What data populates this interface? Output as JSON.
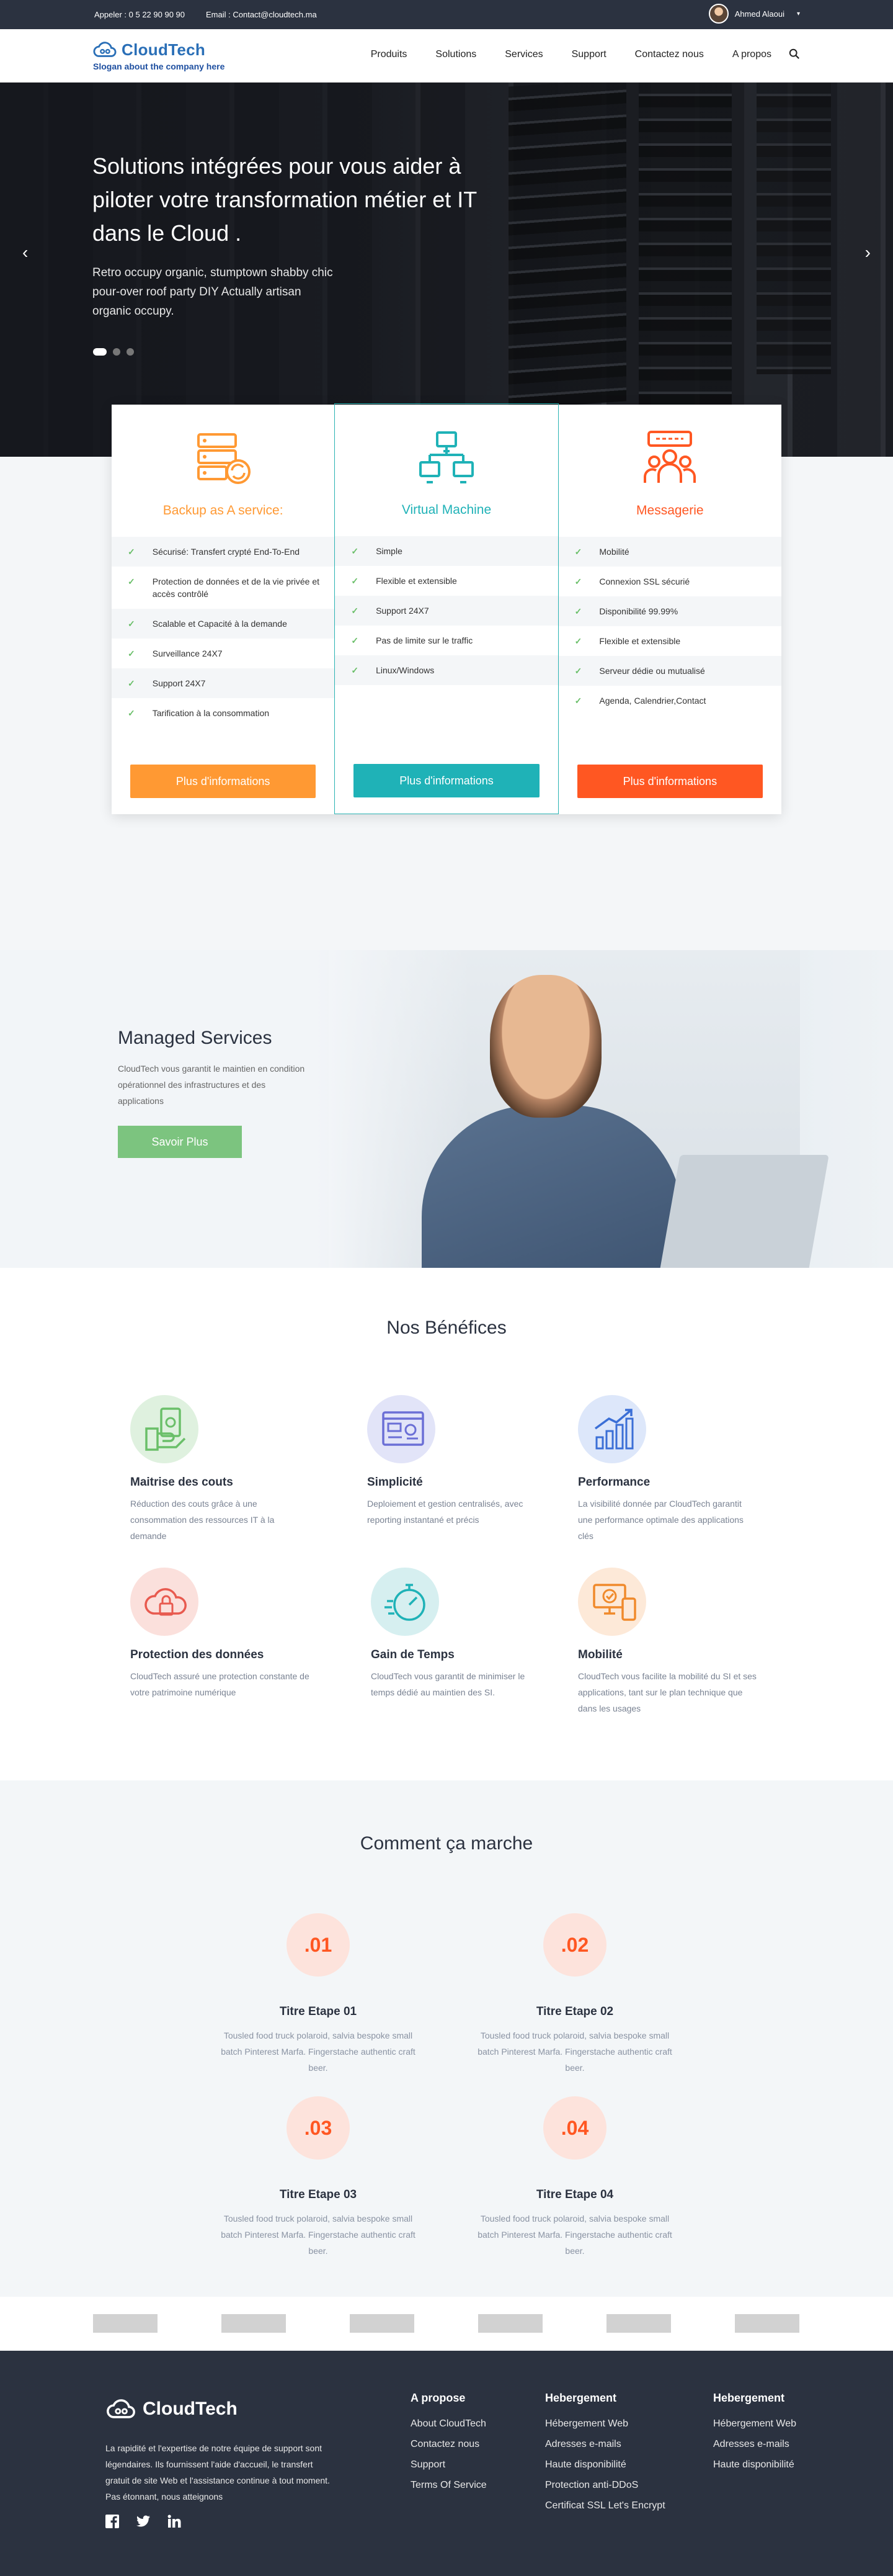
{
  "topbar": {
    "phone": "Appeler : 0 5 22 90 90 90",
    "email": "Email : Contact@cloudtech.ma",
    "user_name": "Ahmed Alaoui",
    "caret": "▾"
  },
  "header": {
    "logo_text": "CloudTech",
    "slogan": "Slogan about the company here",
    "nav": [
      "Produits",
      "Solutions",
      "Services",
      "Support",
      "Contactez nous",
      "A propos"
    ]
  },
  "hero": {
    "title": "Solutions intégrées pour vous aider à piloter votre transformation métier et IT dans le Cloud .",
    "text": "Retro occupy organic, stumptown shabby chic pour-over roof party DIY  Actually artisan organic occupy.",
    "prev": "‹",
    "next": "›"
  },
  "cards": [
    {
      "title": "Backup as A service:",
      "color": "#ff9933",
      "icon": "server-backup-icon",
      "features": [
        "Sécurisé:  Transfert crypté End-To-End",
        "Protection de données et de la vie privée et accès contrôlé",
        "Scalable et Capacité à la demande",
        "Surveillance 24X7",
        "Support 24X7",
        "Tarification à la consommation"
      ],
      "button": "Plus d'informations"
    },
    {
      "title": "Virtual Machine",
      "color": "#1fb2b7",
      "icon": "network-monitors-icon",
      "features": [
        "Simple",
        "Flexible et extensible",
        "Support 24X7",
        "Pas de limite sur le traffic",
        "Linux/Windows"
      ],
      "button": "Plus d'informations"
    },
    {
      "title": "Messagerie",
      "color": "#ff5722",
      "icon": "team-chat-icon",
      "features": [
        "Mobilité",
        "Connexion SSL sécurié",
        "Disponibilité 99.99%",
        "Flexible et extensible",
        "Serveur dédie ou mutualisé",
        "Agenda, Calendrier,Contact"
      ],
      "button": "Plus d'informations"
    }
  ],
  "managed": {
    "title": "Managed Services",
    "text": "CloudTech vous garantit le maintien en condition opérationnel des infrastructures et des applications",
    "button": "Savoir Plus"
  },
  "benefits": {
    "title": "Nos Bénéfices",
    "items": [
      {
        "title": "Maitrise des couts",
        "text": "Réduction des couts grâce à une consommation des ressources IT à la demande",
        "icon": "money-icon",
        "tint": "#dff1df",
        "color": "#6abf69"
      },
      {
        "title": "Simplicité",
        "text": "Deploiement et gestion centralisés, avec reporting instantané et précis",
        "icon": "dashboard-window-icon",
        "tint": "#e2e4f8",
        "color": "#6b6fd6"
      },
      {
        "title": "Performance",
        "text": "La visibilité donnée par CloudTech garantit une performance optimale des applications clés",
        "icon": "growth-chart-icon",
        "tint": "#dde7fa",
        "color": "#3b6fd6"
      },
      {
        "title": "Protection des données",
        "text": "CloudTech assuré une protection constante de votre patrimoine numérique",
        "icon": "cloud-lock-icon",
        "tint": "#fbe0dc",
        "color": "#e85a4f"
      },
      {
        "title": "Gain de Temps",
        "text": "CloudTech vous garantit de minimiser le temps dédié au maintien des SI.",
        "icon": "stopwatch-icon",
        "tint": "#d6eff0",
        "color": "#1fb2b7"
      },
      {
        "title": "Mobilité",
        "text": "CloudTech vous facilite la mobilité du SI et ses applications, tant sur le plan technique que dans les usages",
        "icon": "devices-check-icon",
        "tint": "#fde9d8",
        "color": "#f08a2c"
      }
    ]
  },
  "how": {
    "title": "Comment ça marche",
    "steps": [
      {
        "num": ".01",
        "title": "Titre Etape 01",
        "text": "Tousled food truck polaroid, salvia bespoke small batch Pinterest Marfa. Fingerstache authentic craft beer."
      },
      {
        "num": ".02",
        "title": "Titre Etape 02",
        "text": "Tousled food truck polaroid, salvia bespoke small batch Pinterest Marfa. Fingerstache authentic craft beer."
      },
      {
        "num": ".03",
        "title": "Titre Etape 03",
        "text": "Tousled food truck polaroid, salvia bespoke small batch Pinterest Marfa. Fingerstache authentic craft beer."
      },
      {
        "num": ".04",
        "title": "Titre Etape 04",
        "text": "Tousled food truck polaroid, salvia bespoke small batch Pinterest Marfa. Fingerstache authentic craft beer."
      }
    ]
  },
  "footer": {
    "logo_text": "CloudTech",
    "about": "La rapidité et l'expertise de notre équipe de support sont légendaires. Ils fournissent l'aide d'accueil, le transfert gratuit de site Web et l'assistance continue à tout moment. Pas étonnant, nous atteignons",
    "columns": [
      {
        "title": "A propose",
        "links": [
          "About CloudTech",
          "Contactez nous",
          "Support",
          "Terms Of Service"
        ]
      },
      {
        "title": "Hebergement",
        "links": [
          "Hébergement Web",
          "Adresses e-mails",
          "Haute disponibilité",
          "Protection anti-DDoS",
          "Certificat SSL Let's Encrypt"
        ]
      },
      {
        "title": "Hebergement",
        "links": [
          "Hébergement Web",
          "Adresses e-mails",
          "Haute disponibilité"
        ]
      }
    ]
  }
}
